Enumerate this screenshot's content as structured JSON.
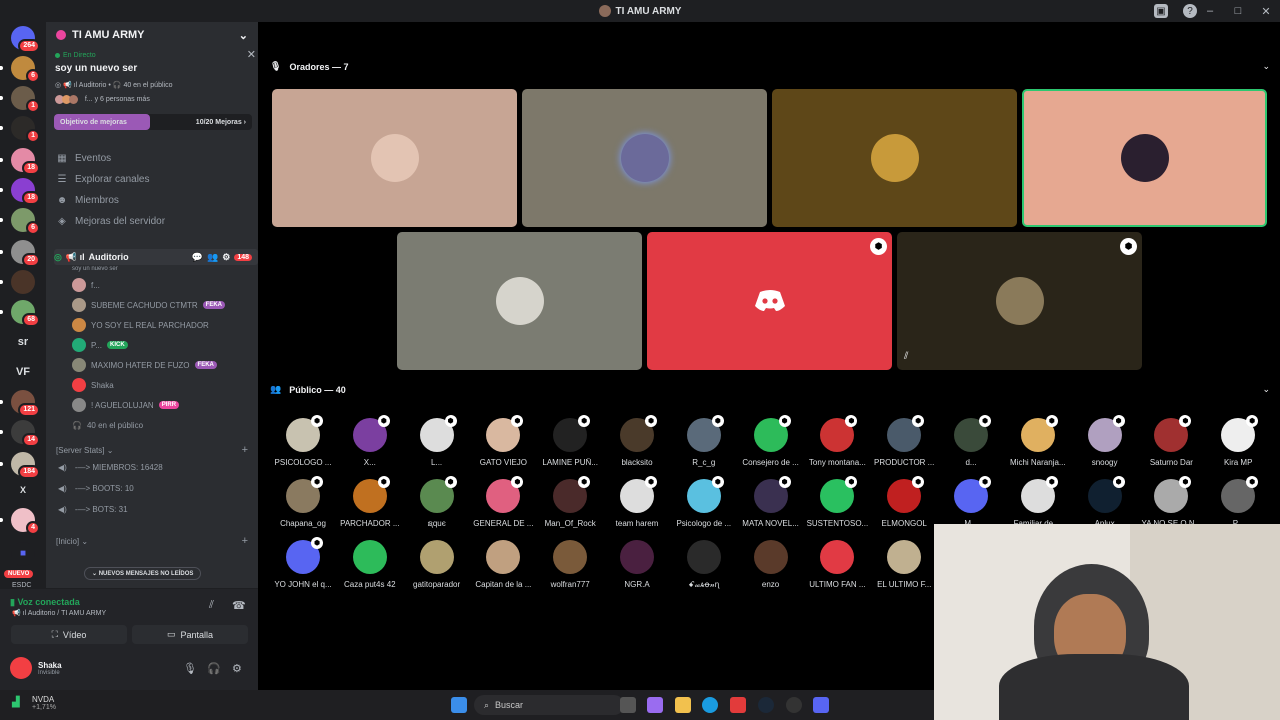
{
  "window": {
    "title": "TI AMU ARMY"
  },
  "rail": {
    "items": [
      {
        "name": "discord-home",
        "badge": "264",
        "color": "#5865f2"
      },
      {
        "name": "server-1",
        "badge": "6",
        "color": "#c08a3e"
      },
      {
        "name": "server-2",
        "badge": "1",
        "color": "#6b5c4a"
      },
      {
        "name": "server-3",
        "badge": "1",
        "color": "#2c2a28"
      },
      {
        "name": "server-4",
        "badge": "18",
        "color": "#e48aa6"
      },
      {
        "name": "server-5",
        "badge": "18",
        "color": "#8a3fd1"
      },
      {
        "name": "server-6",
        "badge": "6",
        "color": "#7d9a6a"
      },
      {
        "name": "server-7",
        "badge": "20",
        "color": "#8f8f8f"
      },
      {
        "name": "server-8",
        "badge": "",
        "color": "#4a3428"
      },
      {
        "name": "server-9",
        "badge": "68",
        "color": "#6fa86a"
      }
    ],
    "text_items": [
      "sr",
      "VF"
    ],
    "lower_items": [
      {
        "name": "server-10",
        "badge": "121",
        "color": "#7a5040"
      },
      {
        "name": "server-11",
        "badge": "14",
        "color": "#3c3c3c"
      },
      {
        "name": "server-12",
        "badge": "184",
        "color": "#c0b8a8"
      },
      {
        "name": "server-13",
        "badge": "4",
        "color": "#f0c0c8"
      }
    ],
    "x_label": "X",
    "nuevo_label": "NUEVO",
    "esdc_label": "ESDC"
  },
  "server": {
    "name": "TI AMU ARMY"
  },
  "live": {
    "label": "En Directo",
    "title": "soy un nuevo ser",
    "meta": "Auditorio",
    "audience": "40 en el público",
    "people": "f... y 6 personas más"
  },
  "boost": {
    "label": "Objetivo de mejoras",
    "progress": "10/20 Mejoras",
    "fraction": 0.5
  },
  "nav": [
    {
      "icon": "calendar-icon",
      "glyph": "▦",
      "label": "Eventos"
    },
    {
      "icon": "compass-icon",
      "glyph": "☰",
      "label": "Explorar canales"
    },
    {
      "icon": "members-icon",
      "glyph": "☻",
      "label": "Miembros"
    },
    {
      "icon": "boost-icon",
      "glyph": "◈",
      "label": "Mejoras del servidor"
    }
  ],
  "stage": {
    "name": "Auditorio",
    "subtitle": "soy un nuevo ser",
    "badge": "148",
    "members": [
      {
        "name": "f...",
        "tag": "",
        "tagcolor": "",
        "color": "#c99"
      },
      {
        "name": "SUBEME CACHUDO CTMTR",
        "tag": "FEKA",
        "tagcolor": "#9b59b6",
        "color": "#a98"
      },
      {
        "name": "YO SOY EL REAL PARCHADOR",
        "tag": "",
        "tagcolor": "",
        "color": "#c84"
      },
      {
        "name": "P...",
        "tag": "KICK",
        "tagcolor": "#23a55a",
        "color": "#2a7"
      },
      {
        "name": "MAXIMO HATER DE FUZO",
        "tag": "FEKA",
        "tagcolor": "#9b59b6",
        "color": "#887"
      },
      {
        "name": "Shaka",
        "tag": "",
        "tagcolor": "",
        "color": "#f23f43"
      },
      {
        "name": "! AGUELOLUJAN",
        "tag": "PIRR",
        "tagcolor": "#eb459e",
        "color": "#888"
      }
    ],
    "audience": "40 en el público"
  },
  "categories": {
    "stats": "Server Stats",
    "inicio": "Inicio"
  },
  "stats": [
    {
      "label": "MIEMBROS: 16428"
    },
    {
      "label": "BOOTS: 10"
    },
    {
      "label": "BOTS: 31"
    }
  ],
  "unread": "NUEVOS MENSAJES NO LEÍDOS",
  "voice": {
    "status": "Voz conectada",
    "path": "Auditorio / TI AMU ARMY",
    "video": "Vídeo",
    "screen": "Pantalla"
  },
  "user": {
    "name": "Shaka",
    "status": "Invisible"
  },
  "speakers": {
    "header": "Oradores — 7"
  },
  "audience": {
    "header": "Público — 40",
    "members": [
      "PSICOLOGO ...",
      "X...",
      "L...",
      "GATO VIEJO",
      "LAMINE PUÑ...",
      "blacksito",
      "R_c_g",
      "Consejero de ...",
      "Tony montana...",
      "PRODUCTOR ...",
      "d...",
      "Michi Naranja...",
      "snoogy",
      "Saturno Dar",
      "Kira MP",
      "Chapana_og",
      "PARCHADOR ...",
      "ຊquє",
      "GENERAL DE ...",
      "Man_Of_Rock",
      "team harem",
      "Psicologo de ...",
      "MATA NOVEL...",
      "SUSTENTOSO...",
      "ELMONGOL",
      "M...",
      "Familiar de ...",
      "Aplux",
      "YA NO SE Q N...",
      "P...",
      "YO JOHN el q...",
      "Caza put4s 42",
      "gatitoparador",
      "Capitan de la ...",
      "wolfran777",
      "NGR.A",
      "ꗃ𝓌ѧꝋ𝓃ɳ",
      "enzo",
      "ULTIMO FAN ...",
      "EL ULTIMO F..."
    ]
  },
  "taskbar": {
    "stock_name": "NVDA",
    "stock_change": "+1,71%",
    "search": "Buscar"
  }
}
